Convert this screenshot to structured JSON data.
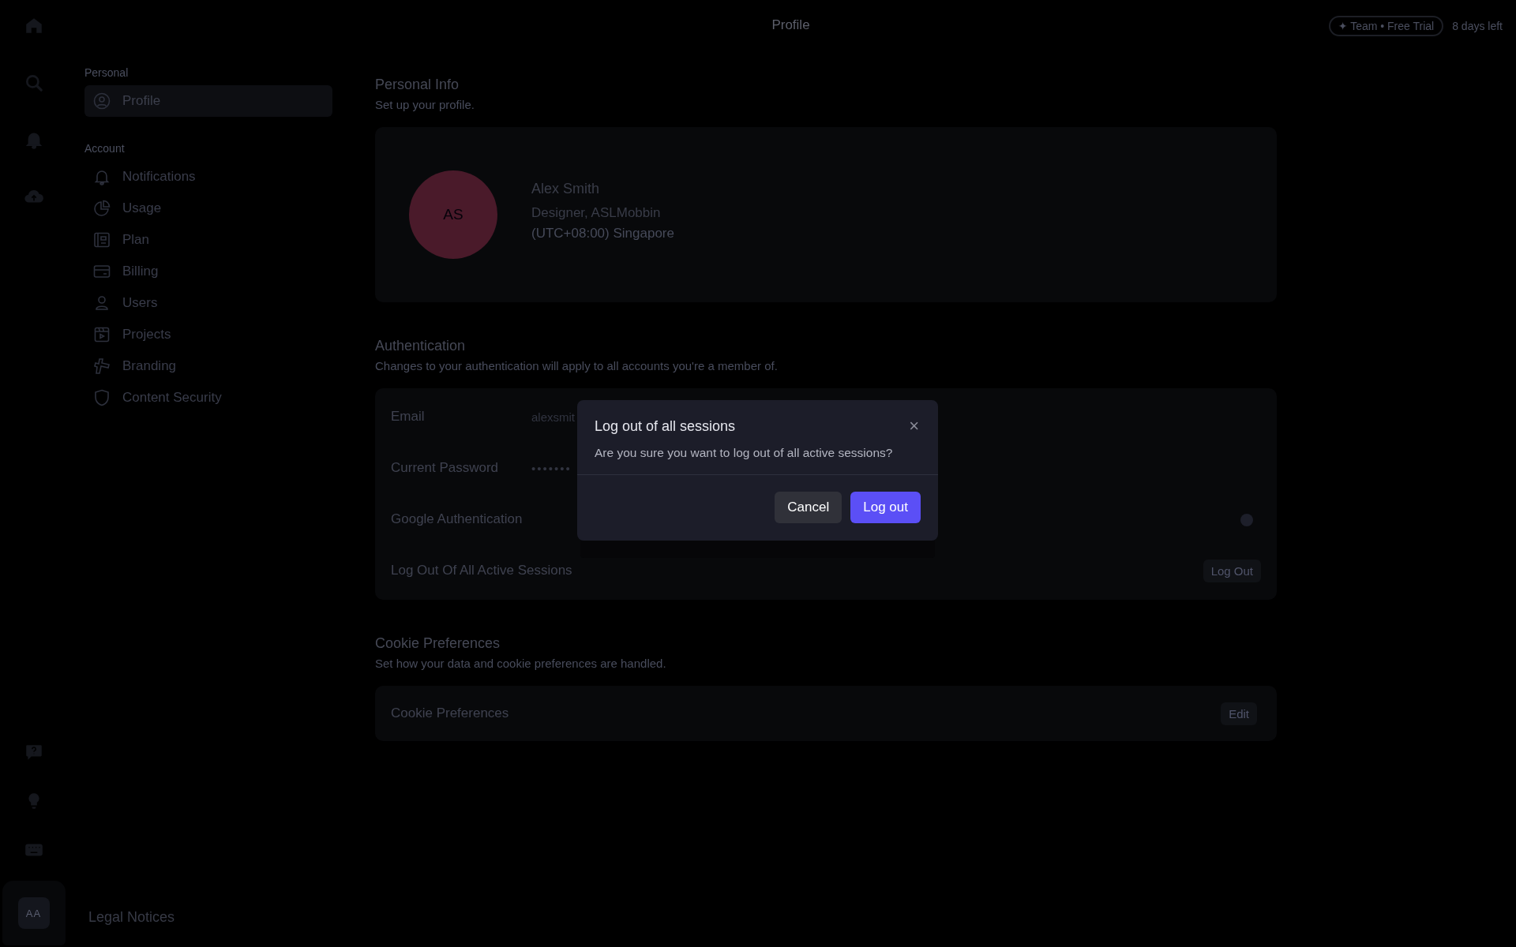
{
  "header": {
    "title": "Profile",
    "plan_badge": {
      "icon": "✦",
      "label": "Team • Free Trial"
    },
    "trial_remaining": "8 days left"
  },
  "rail": {
    "avatar": "AA"
  },
  "sidebar": {
    "sections": [
      {
        "title": "Personal",
        "items": [
          {
            "label": "Profile",
            "selected": true
          }
        ]
      },
      {
        "title": "Account",
        "items": [
          {
            "label": "Notifications",
            "selected": false
          },
          {
            "label": "Usage",
            "selected": false
          },
          {
            "label": "Plan",
            "selected": false
          },
          {
            "label": "Billing",
            "selected": false
          },
          {
            "label": "Users",
            "selected": false
          },
          {
            "label": "Projects",
            "selected": false
          },
          {
            "label": "Branding",
            "selected": false
          },
          {
            "label": "Content Security",
            "selected": false
          }
        ]
      }
    ],
    "footer_link": "Legal Notices"
  },
  "personal_info": {
    "title": "Personal Info",
    "subtitle": "Set up your profile.",
    "avatar_initials": "AS",
    "name": "Alex Smith",
    "role": "Designer, ASLMobbin",
    "timezone": "(UTC+08:00) Singapore"
  },
  "authentication": {
    "title": "Authentication",
    "subtitle": "Changes to your authentication will apply to all accounts you're a member of.",
    "rows": [
      {
        "kind": "text",
        "label": "Email",
        "value": "alexsmit"
      },
      {
        "kind": "password",
        "label": "Current Password",
        "value": "•••••••"
      },
      {
        "kind": "toggle",
        "label": "Google Authentication",
        "on": false
      },
      {
        "kind": "button",
        "label": "Log Out Of All Active Sessions",
        "button": "Log Out"
      }
    ]
  },
  "cookies": {
    "title": "Cookie Preferences",
    "subtitle": "Set how your data and cookie preferences are handled.",
    "row_label": "Cookie Preferences",
    "button": "Edit"
  },
  "dialog": {
    "title": "Log out of all sessions",
    "message": "Are you sure you want to log out of all active sessions?",
    "close": "×",
    "buttons": [
      {
        "label": "Cancel",
        "kind": "secondary"
      },
      {
        "label": "Log out",
        "kind": "primary"
      }
    ]
  }
}
